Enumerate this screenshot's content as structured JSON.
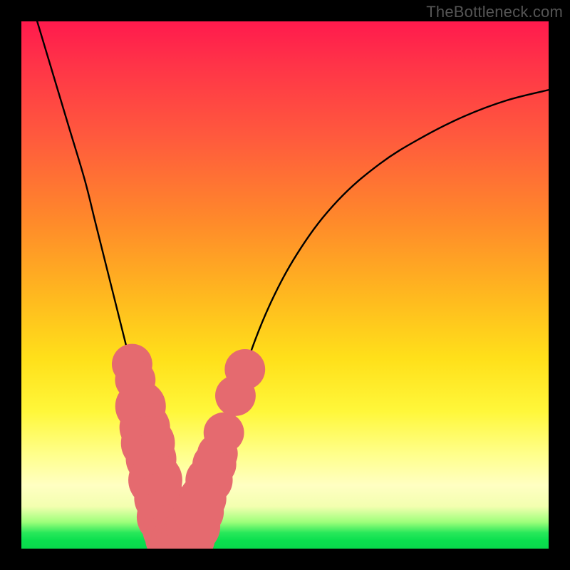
{
  "watermark": "TheBottleneck.com",
  "colors": {
    "frame": "#000000",
    "curve": "#000000",
    "marker": "#e56a6f",
    "gradient_stops": [
      "#ff1a4d",
      "#ff3348",
      "#ff5a3d",
      "#ff8a2a",
      "#ffb81f",
      "#ffe01a",
      "#fff73a",
      "#ffff8a",
      "#ffffc2",
      "#f3ffb0",
      "#9cff7a",
      "#28e85a",
      "#0adf4e",
      "#09d84c"
    ]
  },
  "chart_data": {
    "type": "line",
    "title": "",
    "xlabel": "",
    "ylabel": "",
    "xlim": [
      0,
      100
    ],
    "ylim": [
      0,
      100
    ],
    "note": "Axes are unlabeled; values are normalized 0–100 from pixel positions. y is plotted with 0 at the bottom of the plot area.",
    "series": [
      {
        "name": "bottleneck-curve",
        "x": [
          3,
          6,
          9,
          12,
          14,
          16,
          18,
          20,
          22,
          24,
          25.5,
          27,
          28.5,
          30,
          32,
          35,
          38,
          42,
          47,
          53,
          60,
          68,
          76,
          84,
          92,
          100
        ],
        "y": [
          100,
          90,
          80,
          70,
          62,
          54,
          46,
          38,
          30,
          21,
          13,
          6,
          2,
          1,
          3,
          10,
          20,
          33,
          46,
          57,
          66,
          73,
          78,
          82,
          85,
          87
        ]
      }
    ],
    "markers": {
      "name": "highlighted-points",
      "points": [
        {
          "x": 21.0,
          "y": 35.0,
          "r": 1.2
        },
        {
          "x": 21.6,
          "y": 32.0,
          "r": 1.2
        },
        {
          "x": 22.6,
          "y": 27.0,
          "r": 1.5
        },
        {
          "x": 23.4,
          "y": 23.0,
          "r": 1.5
        },
        {
          "x": 24.0,
          "y": 20.0,
          "r": 1.6
        },
        {
          "x": 24.6,
          "y": 17.0,
          "r": 1.5
        },
        {
          "x": 25.4,
          "y": 13.0,
          "r": 1.6
        },
        {
          "x": 26.2,
          "y": 9.5,
          "r": 1.5
        },
        {
          "x": 27.0,
          "y": 6.0,
          "r": 1.6
        },
        {
          "x": 27.8,
          "y": 3.5,
          "r": 1.5
        },
        {
          "x": 28.6,
          "y": 2.0,
          "r": 1.6
        },
        {
          "x": 29.6,
          "y": 1.2,
          "r": 1.6
        },
        {
          "x": 30.6,
          "y": 1.2,
          "r": 1.6
        },
        {
          "x": 31.6,
          "y": 2.0,
          "r": 1.6
        },
        {
          "x": 32.6,
          "y": 4.2,
          "r": 1.6
        },
        {
          "x": 33.6,
          "y": 7.0,
          "r": 1.5
        },
        {
          "x": 34.4,
          "y": 9.5,
          "r": 1.4
        },
        {
          "x": 35.6,
          "y": 13.0,
          "r": 1.4
        },
        {
          "x": 36.6,
          "y": 16.0,
          "r": 1.3
        },
        {
          "x": 37.2,
          "y": 18.0,
          "r": 1.2
        },
        {
          "x": 38.4,
          "y": 22.0,
          "r": 1.2
        },
        {
          "x": 40.6,
          "y": 29.0,
          "r": 1.2
        },
        {
          "x": 42.4,
          "y": 34.0,
          "r": 1.2
        }
      ]
    }
  }
}
